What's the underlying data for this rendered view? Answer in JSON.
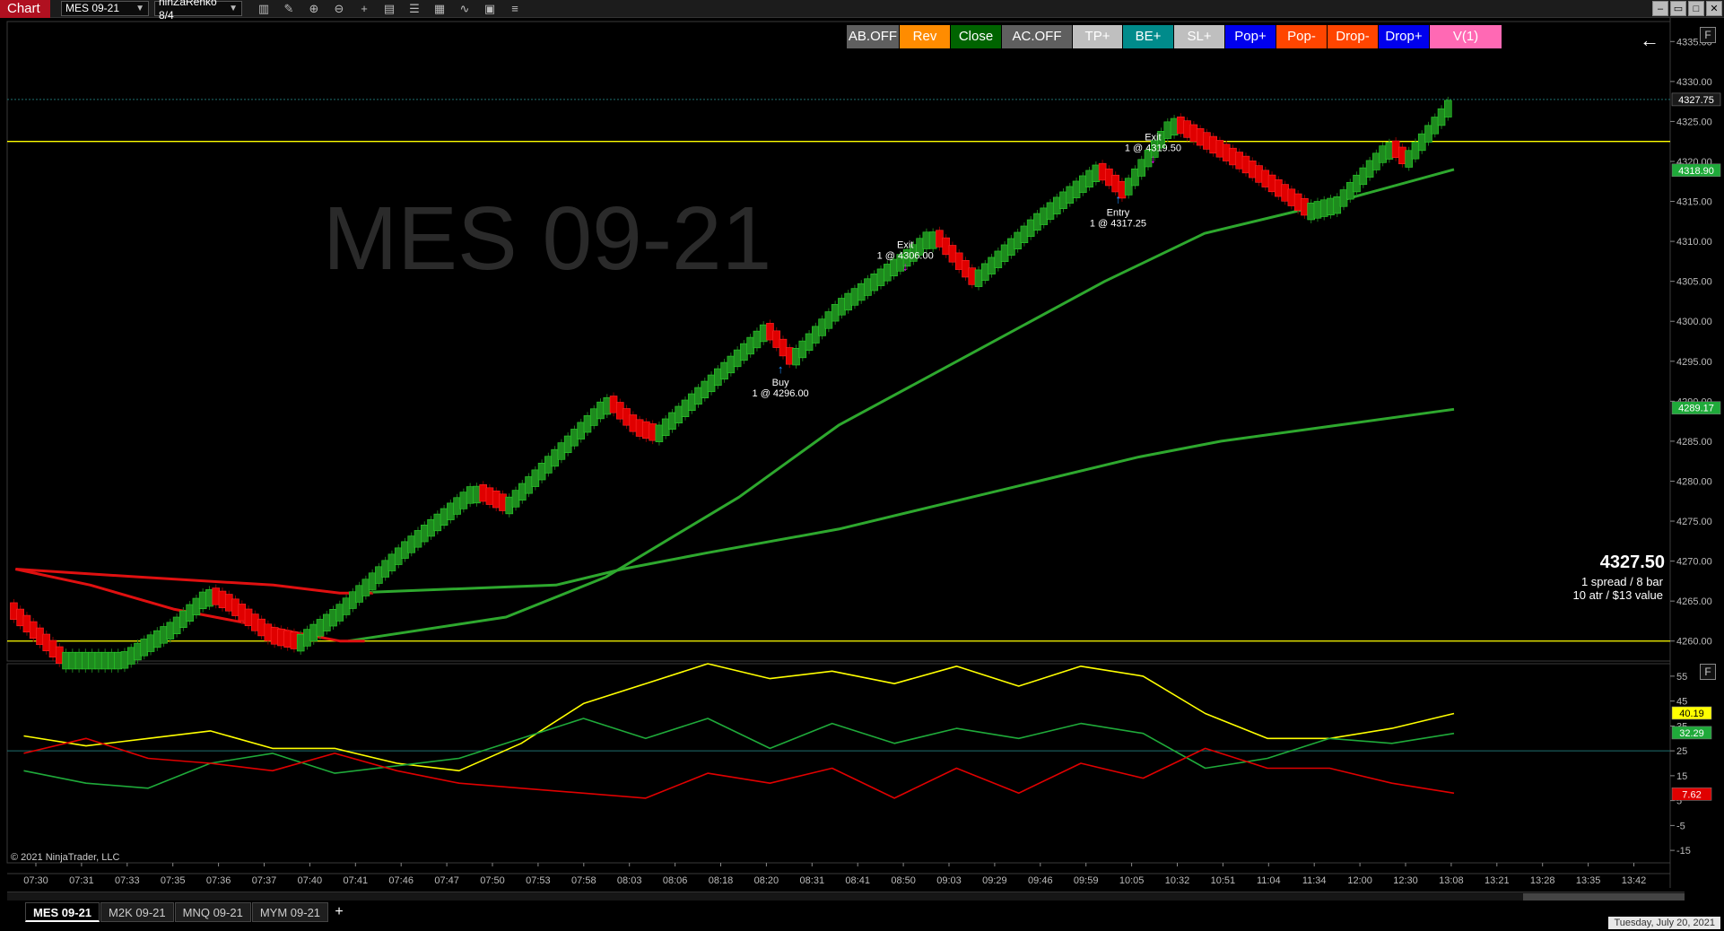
{
  "toolbar": {
    "chart_label": "Chart",
    "instrument": "MES 09-21",
    "bar_type": "ninZaRenko 8/4",
    "icons": [
      "bars-icon",
      "draw-icon",
      "zoom-in-icon",
      "zoom-out-icon",
      "crosshair-icon",
      "data-box-icon",
      "templates-icon",
      "strategies-icon",
      "indicators-icon",
      "properties-icon"
    ],
    "window_controls": [
      "minimize-icon",
      "restore-icon",
      "maximize-icon",
      "close-icon"
    ]
  },
  "chart_trader": {
    "buttons": [
      {
        "label": "AB.OFF",
        "color": "#5f5f5f",
        "width": 58
      },
      {
        "label": "Rev",
        "color": "#ff8c00",
        "width": 56
      },
      {
        "label": "Close",
        "color": "#006400",
        "width": 56
      },
      {
        "label": "AC.OFF",
        "color": "#5f5f5f",
        "width": 78
      },
      {
        "label": "TP+",
        "color": "#bfbfbf",
        "width": 55
      },
      {
        "label": "BE+",
        "color": "#008b8b",
        "width": 56
      },
      {
        "label": "SL+",
        "color": "#bfbfbf",
        "width": 56
      },
      {
        "label": "Pop+",
        "color": "#0000ee",
        "width": 56
      },
      {
        "label": "Pop-",
        "color": "#ff4500",
        "width": 56
      },
      {
        "label": "Drop-",
        "color": "#ff4500",
        "width": 56
      },
      {
        "label": "Drop+",
        "color": "#0000ee",
        "width": 56
      },
      {
        "label": "V(1)",
        "color": "#ff69b4",
        "width": 80
      }
    ],
    "back_arrow": "←"
  },
  "watermark": "MES 09-21",
  "info": {
    "price": "4327.50",
    "line1": "1 spread / 8 bar",
    "line2": "10 atr / $13 value"
  },
  "copyright": "© 2021 NinjaTrader, LLC",
  "panel_button": "F",
  "price_axis": {
    "labels": [
      "4335.00",
      "4330.00",
      "4325.00",
      "4320.00",
      "4315.00",
      "4310.00",
      "4305.00",
      "4300.00",
      "4295.00",
      "4290.00",
      "4285.00",
      "4280.00",
      "4275.00",
      "4270.00",
      "4265.00",
      "4260.00"
    ],
    "markers": [
      {
        "label": "4327.75",
        "value": 4327.75,
        "bg": "#1a1a1a",
        "fg": "#fff"
      },
      {
        "label": "4318.90",
        "value": 4318.9,
        "bg": "#1faa3a",
        "fg": "#fff"
      },
      {
        "label": "4289.17",
        "value": 4289.17,
        "bg": "#1faa3a",
        "fg": "#fff"
      }
    ]
  },
  "osc_axis": {
    "labels": [
      "55",
      "45",
      "35",
      "25",
      "15",
      "5",
      "-5",
      "-15"
    ],
    "markers": [
      {
        "label": "40.19",
        "value": 40.19,
        "bg": "#ffff00",
        "fg": "#000"
      },
      {
        "label": "32.29",
        "value": 32.29,
        "bg": "#1faa3a",
        "fg": "#fff"
      },
      {
        "label": "7.62",
        "value": 7.62,
        "bg": "#e00000",
        "fg": "#fff"
      }
    ]
  },
  "time_axis": [
    "07:30",
    "07:31",
    "07:33",
    "07:35",
    "07:36",
    "07:37",
    "07:40",
    "07:41",
    "07:46",
    "07:47",
    "07:50",
    "07:53",
    "07:58",
    "08:03",
    "08:06",
    "08:18",
    "08:20",
    "08:31",
    "08:41",
    "08:50",
    "09:03",
    "09:29",
    "09:46",
    "09:59",
    "10:05",
    "10:32",
    "10:51",
    "11:04",
    "11:34",
    "12:00",
    "12:30",
    "13:08",
    "13:21",
    "13:28",
    "13:35",
    "13:42"
  ],
  "trades": [
    {
      "type": "Buy",
      "text": "1 @ 4296.00",
      "value": 4296.0,
      "bar": 0.465,
      "dir": "up",
      "color": "#1e90ff"
    },
    {
      "type": "Exit",
      "text": "1 @ 4306.00",
      "value": 4306.0,
      "bar": 0.54,
      "dir": "down",
      "color": "#ff00ff"
    },
    {
      "type": "Entry",
      "text": "1 @ 4317.25",
      "value": 4317.25,
      "bar": 0.668,
      "dir": "up",
      "color": "#1e90ff"
    },
    {
      "type": "Exit",
      "text": "1 @ 4319.50",
      "value": 4319.5,
      "bar": 0.689,
      "dir": "down",
      "color": "#ff00ff"
    }
  ],
  "horizontal_lines": [
    {
      "value": 4322.5,
      "color": "#ffff00"
    },
    {
      "value": 4260.0,
      "color": "#ffff00"
    }
  ],
  "tabs": [
    "MES 09-21",
    "M2K 09-21",
    "MNQ 09-21",
    "MYM 09-21"
  ],
  "add_tab": "+",
  "status_date": "Tuesday, July 20, 2021",
  "chart_data": {
    "type": "line",
    "price_range": [
      4257.5,
      4337.5
    ],
    "osc_range": [
      -20,
      60
    ],
    "renko_close_path": [
      [
        0.0,
        4264
      ],
      [
        0.03,
        4258
      ],
      [
        0.07,
        4258
      ],
      [
        0.1,
        4262
      ],
      [
        0.12,
        4266
      ],
      [
        0.13,
        4265
      ],
      [
        0.155,
        4261
      ],
      [
        0.175,
        4260
      ],
      [
        0.2,
        4264
      ],
      [
        0.24,
        4272
      ],
      [
        0.28,
        4279
      ],
      [
        0.3,
        4277
      ],
      [
        0.36,
        4290
      ],
      [
        0.375,
        4287
      ],
      [
        0.39,
        4286
      ],
      [
        0.455,
        4299
      ],
      [
        0.47,
        4295
      ],
      [
        0.5,
        4302
      ],
      [
        0.545,
        4309
      ],
      [
        0.555,
        4311
      ],
      [
        0.58,
        4305
      ],
      [
        0.62,
        4313
      ],
      [
        0.655,
        4319
      ],
      [
        0.67,
        4316
      ],
      [
        0.7,
        4325
      ],
      [
        0.74,
        4320
      ],
      [
        0.78,
        4314
      ],
      [
        0.8,
        4315
      ],
      [
        0.83,
        4322
      ],
      [
        0.84,
        4320
      ],
      [
        0.87,
        4328
      ]
    ],
    "series": [
      {
        "name": "",
        "color": "#2ea82e",
        "points": [
          [
            0.205,
            4260
          ],
          [
            0.3,
            4263
          ],
          [
            0.36,
            4268
          ],
          [
            0.44,
            4278
          ],
          [
            0.5,
            4287
          ],
          [
            0.58,
            4296
          ],
          [
            0.66,
            4305
          ],
          [
            0.72,
            4311
          ],
          [
            0.8,
            4315
          ],
          [
            0.87,
            4319
          ]
        ]
      },
      {
        "name": "",
        "color": "#2ea82e",
        "points": [
          [
            0.205,
            4266
          ],
          [
            0.33,
            4267
          ],
          [
            0.37,
            4269
          ],
          [
            0.42,
            4271
          ],
          [
            0.5,
            4274
          ],
          [
            0.56,
            4277
          ],
          [
            0.62,
            4280
          ],
          [
            0.68,
            4283
          ],
          [
            0.73,
            4285
          ],
          [
            0.8,
            4287
          ],
          [
            0.87,
            4289
          ]
        ]
      },
      {
        "name": "",
        "color": "#e01010",
        "points": [
          [
            0.005,
            4269
          ],
          [
            0.08,
            4268
          ],
          [
            0.16,
            4267
          ],
          [
            0.2,
            4266
          ],
          [
            0.22,
            4266
          ]
        ]
      },
      {
        "name": "",
        "color": "#e01010",
        "points": [
          [
            0.005,
            4269
          ],
          [
            0.05,
            4267
          ],
          [
            0.1,
            4264
          ],
          [
            0.15,
            4262
          ],
          [
            0.2,
            4260
          ],
          [
            0.215,
            4260
          ]
        ]
      }
    ],
    "oscillator": [
      {
        "name": "",
        "color": "#ffff00",
        "values": [
          31,
          27,
          30,
          33,
          26,
          26,
          20,
          17,
          28,
          44,
          52,
          60,
          54,
          57,
          52,
          59,
          51,
          59,
          55,
          40,
          30,
          30,
          34,
          40
        ]
      },
      {
        "name": "",
        "color": "#1faa3a",
        "values": [
          17,
          12,
          10,
          20,
          24,
          16,
          19,
          22,
          30,
          38,
          30,
          38,
          26,
          36,
          28,
          34,
          30,
          36,
          32,
          18,
          22,
          30,
          28,
          32
        ]
      },
      {
        "name": "",
        "color": "#e00000",
        "values": [
          24,
          30,
          22,
          20,
          17,
          24,
          17,
          12,
          10,
          8,
          6,
          16,
          12,
          18,
          6,
          18,
          8,
          20,
          14,
          26,
          18,
          18,
          12,
          8
        ]
      }
    ],
    "osc_level": 25
  }
}
